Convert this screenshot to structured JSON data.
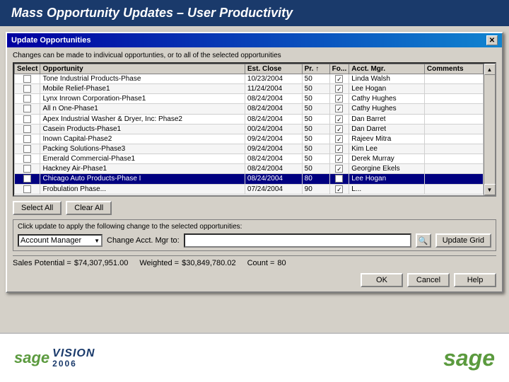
{
  "header": {
    "title": "Mass Opportunity Updates – User Productivity"
  },
  "dialog": {
    "title": "Update Opportunities",
    "subtitle": "Changes can be made to indivicual opportunties, or to all of the selected opportunities",
    "table": {
      "columns": [
        "Select",
        "Opportunity",
        "Est. Close",
        "Pr.",
        "Fo...",
        "Acct. Mgr.",
        "Comments"
      ],
      "rows": [
        {
          "select": false,
          "opportunity": "Tone Industrial Products-Phase",
          "est_close": "10/23/2004",
          "pr": "50",
          "fo": true,
          "acct_mgr": "Linda Walsh",
          "comments": "",
          "selected": false
        },
        {
          "select": false,
          "opportunity": "Mobile Relief-Phase1",
          "est_close": "11/24/2004",
          "pr": "50",
          "fo": true,
          "acct_mgr": "Lee Hogan",
          "comments": "",
          "selected": false
        },
        {
          "select": false,
          "opportunity": "Lynx Inrown Corporation-Phase1",
          "est_close": "08/24/2004",
          "pr": "50",
          "fo": true,
          "acct_mgr": "Cathy Hughes",
          "comments": "",
          "selected": false
        },
        {
          "select": false,
          "opportunity": "All n One-Phase1",
          "est_close": "08/24/2004",
          "pr": "50",
          "fo": true,
          "acct_mgr": "Cathy Hughes",
          "comments": "",
          "selected": false
        },
        {
          "select": false,
          "opportunity": "Apex Industrial Washer & Dryer, Inc: Phase2",
          "est_close": "08/24/2004",
          "pr": "50",
          "fo": true,
          "acct_mgr": "Dan Barret",
          "comments": "",
          "selected": false
        },
        {
          "select": false,
          "opportunity": "Casein Products-Phase1",
          "est_close": "00/24/2004",
          "pr": "50",
          "fo": true,
          "acct_mgr": "Dan Darret",
          "comments": "",
          "selected": false
        },
        {
          "select": false,
          "opportunity": "Inown Capital-Phase2",
          "est_close": "09/24/2004",
          "pr": "50",
          "fo": true,
          "acct_mgr": "Rajeev Mitra",
          "comments": "",
          "selected": false
        },
        {
          "select": false,
          "opportunity": "Packing Solutions-Phase3",
          "est_close": "09/24/2004",
          "pr": "50",
          "fo": true,
          "acct_mgr": "Kim Lee",
          "comments": "",
          "selected": false
        },
        {
          "select": false,
          "opportunity": "Emerald Commercial-Phase1",
          "est_close": "08/24/2004",
          "pr": "50",
          "fo": true,
          "acct_mgr": "Derek Murray",
          "comments": "",
          "selected": false
        },
        {
          "select": false,
          "opportunity": "Hackney Air-Phase1",
          "est_close": "08/24/2004",
          "pr": "50",
          "fo": true,
          "acct_mgr": "Georgine Ekels",
          "comments": "",
          "selected": false
        },
        {
          "select": true,
          "opportunity": "Chicago Auto Products-Phase I",
          "est_close": "08/24/2004",
          "pr": "80",
          "fo": true,
          "acct_mgr": "Lee Hogan",
          "comments": "",
          "selected": true
        },
        {
          "select": false,
          "opportunity": "Frobulation Phase...",
          "est_close": "07/24/2004",
          "pr": "90",
          "fo": true,
          "acct_mgr": "L...",
          "comments": "",
          "selected": false
        }
      ]
    },
    "buttons": {
      "select_all": "Select All",
      "clear_all": "Clear All"
    },
    "update_section": {
      "label": "Click update to apply the following change to the selected opportunities:",
      "dropdown_value": "Account Manager",
      "field_label": "Change Acct. Mgr to:",
      "input_value": "",
      "update_grid": "Update Grid"
    },
    "status": {
      "sales_potential_label": "Sales Potential =",
      "sales_potential_value": "$74,307,951.00",
      "weighted_label": "Weighted =",
      "weighted_value": "$30,849,780.02",
      "count_label": "Count =",
      "count_value": "80"
    },
    "footer": {
      "ok": "OK",
      "cancel": "Cancel",
      "help": "Help"
    }
  },
  "bottom_banner": {
    "sage_left": "sage",
    "vision_text": "VISION",
    "vision_year": "2006",
    "sage_right": "sage"
  }
}
